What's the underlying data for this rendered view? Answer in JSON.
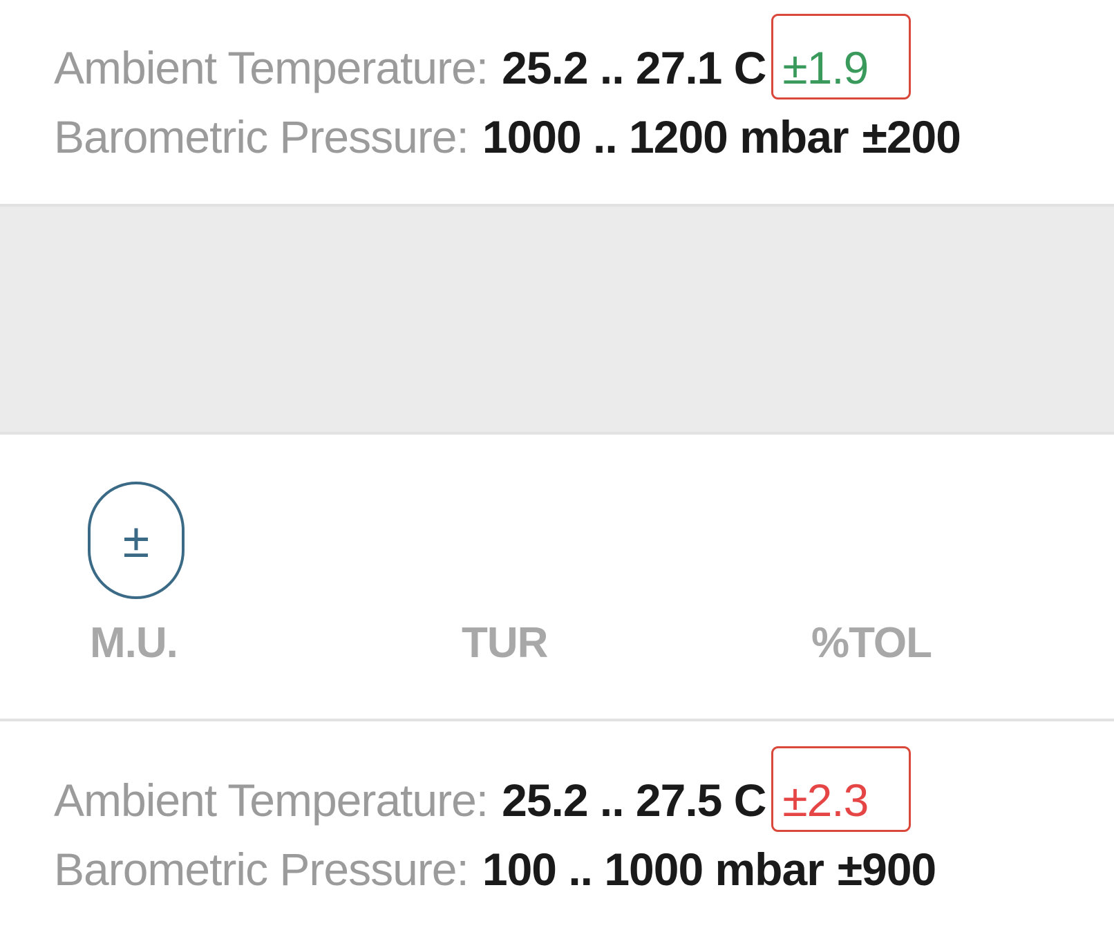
{
  "top": {
    "temperature": {
      "label": "Ambient Temperature:",
      "value": "25.2 .. 27.1 C",
      "delta": "±1.9",
      "delta_status_color": "#3a9a5c"
    },
    "pressure": {
      "label": "Barometric Pressure:",
      "value": "1000 .. 1200 mbar",
      "delta": "±200"
    }
  },
  "toolbar": {
    "mu_button_symbol": "±",
    "columns": {
      "mu": "M.U.",
      "tur": "TUR",
      "tol": "%TOL"
    }
  },
  "bottom": {
    "temperature": {
      "label": "Ambient Temperature:",
      "value": "25.2 .. 27.5 C",
      "delta": "±2.3",
      "delta_status_color": "#e64545"
    },
    "pressure": {
      "label": "Barometric Pressure:",
      "value": "100 .. 1000 mbar",
      "delta": "±900"
    }
  },
  "highlight_color": "#d9483b"
}
